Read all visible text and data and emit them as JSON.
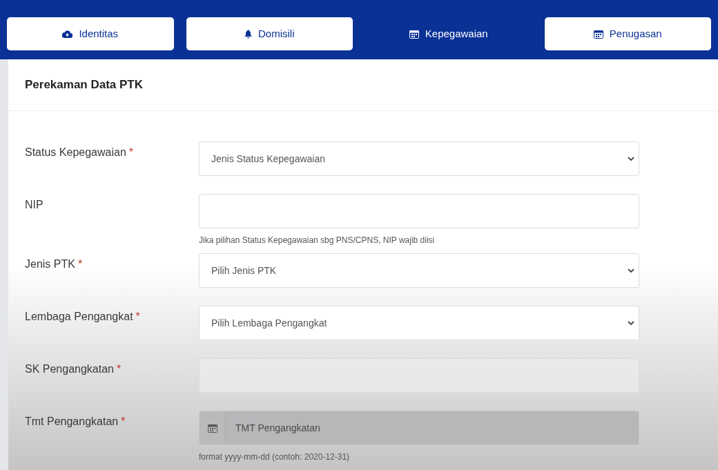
{
  "tabs": [
    {
      "label": "Identitas",
      "selected": false
    },
    {
      "label": "Domisili",
      "selected": false
    },
    {
      "label": "Kepegawaian",
      "selected": true
    },
    {
      "label": "Penugasan",
      "selected": false
    }
  ],
  "card": {
    "title": "Perekaman Data PTK"
  },
  "fields": [
    {
      "kind": "select",
      "label": "Status Kepegawaian",
      "required_mark": "*",
      "placeholder": "Jenis Status Kepegawaian",
      "disabled": false
    },
    {
      "kind": "text",
      "label": "NIP",
      "disabled": false,
      "help": "Jika pilihan Status Kepegawaian sbg PNS/CPNS, NIP wajib diisi"
    },
    {
      "kind": "select",
      "label": "Jenis PTK",
      "required_mark": "*",
      "placeholder": "Pilih Jenis PTK",
      "disabled": false
    },
    {
      "kind": "select",
      "label": "Lembaga Pengangkat",
      "required_mark": "*",
      "placeholder": "Pilih Lembaga Pengangkat",
      "disabled": false
    },
    {
      "kind": "text",
      "label": "SK Pengangkatan",
      "required_mark": "*",
      "disabled": true
    },
    {
      "kind": "date",
      "label": "Tmt Pengangkatan",
      "required_mark": "*",
      "placeholder": "TMT Pengangkatan",
      "disabled": true,
      "help": "format yyyy-mm-dd (contoh: 2020-12-31)"
    }
  ]
}
